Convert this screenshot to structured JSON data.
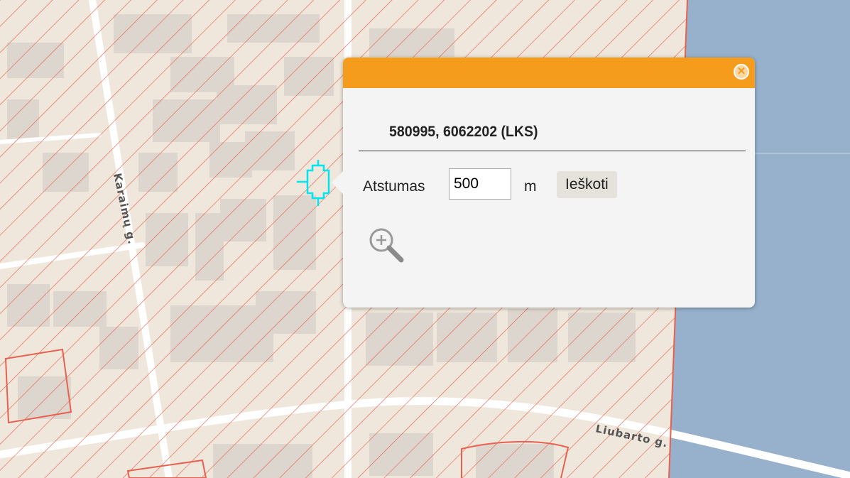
{
  "map": {
    "streets": [
      "Karaimų g.",
      "Liubarto g."
    ],
    "colors": {
      "background": "#efe7dc",
      "building": "#ddd6ce",
      "hatch": "#e8614f",
      "water": "#97b1cd",
      "marker": "#00e5f0"
    }
  },
  "popup": {
    "coordinates": "580995, 6062202 (LKS)",
    "distance_label": "Atstumas",
    "distance_value": "500",
    "unit": "m",
    "search_button": "Ieškoti",
    "icons": {
      "close": "close-circle-icon",
      "zoom": "zoom-in-icon"
    },
    "header_color": "#f59c1c"
  }
}
